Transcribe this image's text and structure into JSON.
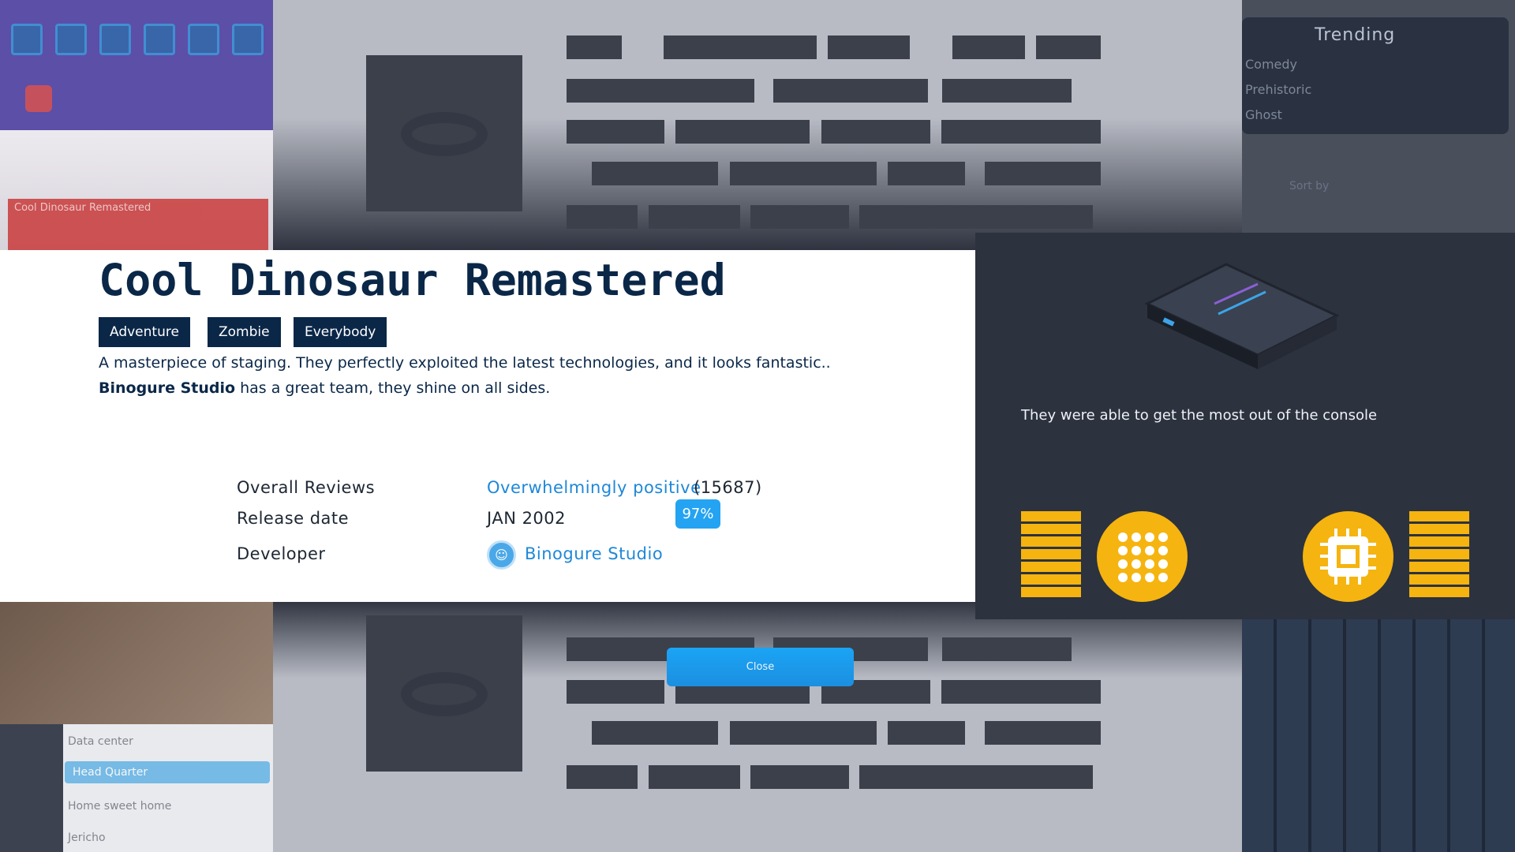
{
  "game": {
    "title": "Cool Dinosaur Remastered",
    "tags": [
      "Adventure",
      "Zombie",
      "Everybody"
    ],
    "description": "A masterpiece of staging. They perfectly exploited the latest technologies, and it looks fantastic..",
    "developer_line_name": "Binogure Studio",
    "developer_line_rest": " has a great team, they shine on all sides.",
    "info": {
      "overall_reviews_label": "Overall Reviews",
      "overall_reviews_value": "Overwhelmingly positive",
      "review_count": "(15687)",
      "review_percent": "97%",
      "release_date_label": "Release date",
      "release_date_value": "JAN 2002",
      "developer_label": "Developer",
      "developer_value": "Binogure Studio"
    }
  },
  "console_panel": {
    "caption": "They were able to get the most out of the console"
  },
  "close_label": "Close",
  "background": {
    "trending_title": "Trending",
    "trending_items": [
      "Comedy",
      "Prehistoric",
      "Ghost"
    ],
    "sort_label": "Sort by",
    "game_card": "Cool Dinosaur Remastered",
    "sidebar_items": [
      "Data center",
      "Head Quarter",
      "Home sweet home",
      "Jericho"
    ]
  },
  "colors": {
    "navy": "#0a2748",
    "accent_blue": "#1e88d8",
    "gold": "#f5b40f",
    "dark_panel": "#2c323e"
  }
}
